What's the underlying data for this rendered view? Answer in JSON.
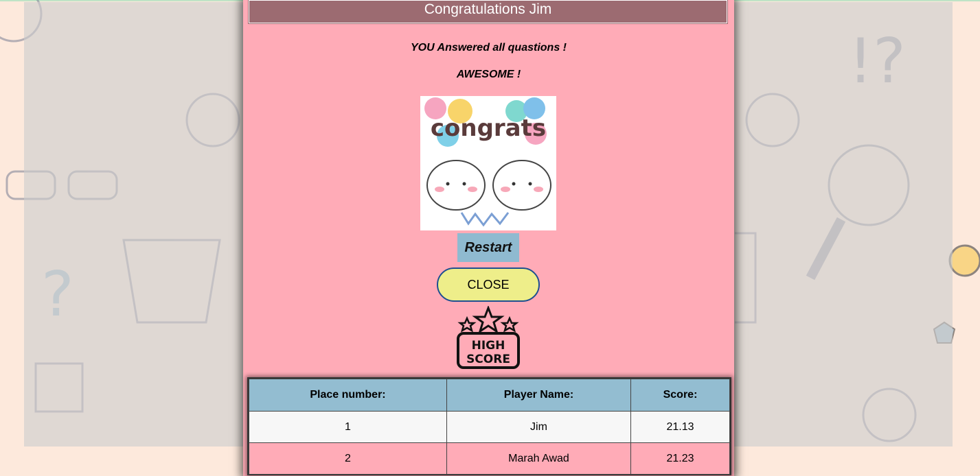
{
  "modal": {
    "title": "Congratulations Jim",
    "message_line1": "YOU Answered all quastions !",
    "message_line2": "AWESOME !",
    "image_text": "congrats",
    "restart_label": "Restart",
    "close_label": "CLOSE",
    "highscore_badge": {
      "line1": "HIGH",
      "line2": "SCORE"
    }
  },
  "scores": {
    "headers": [
      "Place number:",
      "Player Name:",
      "Score:"
    ],
    "rows": [
      [
        "1",
        "Jim",
        "21.13"
      ],
      [
        "2",
        "Marah Awad",
        "21.23"
      ]
    ]
  },
  "colors": {
    "modal_bg": "#ffabb7",
    "title_bar": "#9c6b71",
    "header_bg": "#93bdd1",
    "close_bg": "#eeee8a",
    "restart_bg": "#8fbad0"
  }
}
